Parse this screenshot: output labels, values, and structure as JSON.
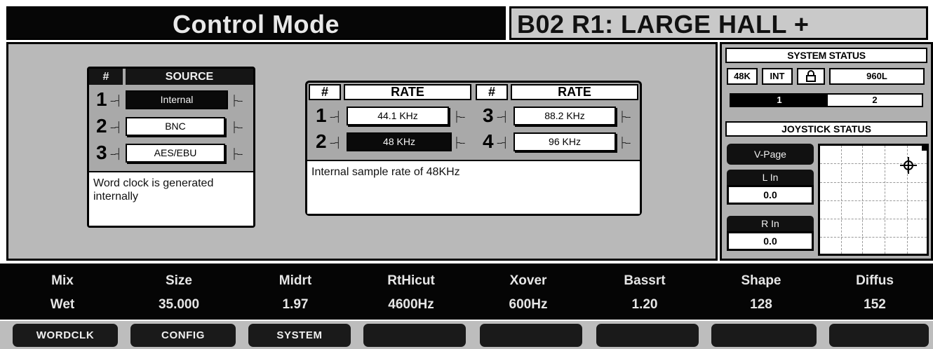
{
  "header": {
    "title": "Control Mode",
    "preset": "B02 R1: LARGE HALL +"
  },
  "source_panel": {
    "hash": "#",
    "header": "SOURCE",
    "rows": [
      {
        "num": "1",
        "label": "Internal"
      },
      {
        "num": "2",
        "label": "BNC"
      },
      {
        "num": "3",
        "label": "AES/EBU"
      }
    ],
    "description": "Word clock is generated internally"
  },
  "rate_panel": {
    "hash": "#",
    "header": "RATE",
    "rows": [
      {
        "num": "1",
        "label": "44.1 KHz"
      },
      {
        "num": "2",
        "label": "48 KHz"
      },
      {
        "num": "3",
        "label": "88.2 KHz"
      },
      {
        "num": "4",
        "label": "96 KHz"
      }
    ],
    "description": "Internal sample rate of 48KHz"
  },
  "system_status": {
    "title": "SYSTEM STATUS",
    "rate": "48K",
    "source": "INT",
    "model": "960L",
    "seg1": "1",
    "seg2": "2"
  },
  "joystick_status": {
    "title": "JOYSTICK STATUS",
    "vpage": "V-Page",
    "l_label": "L In",
    "l_value": "0.0",
    "r_label": "R In",
    "r_value": "0.0"
  },
  "params": [
    {
      "name": "Mix",
      "value": "Wet"
    },
    {
      "name": "Size",
      "value": "35.000"
    },
    {
      "name": "Midrt",
      "value": "1.97"
    },
    {
      "name": "RtHicut",
      "value": "4600Hz"
    },
    {
      "name": "Xover",
      "value": "600Hz"
    },
    {
      "name": "Bassrt",
      "value": "1.20"
    },
    {
      "name": "Shape",
      "value": "128"
    },
    {
      "name": "Diffus",
      "value": "152"
    }
  ],
  "softkeys": [
    {
      "label": "WORDCLK"
    },
    {
      "label": "CONFIG"
    },
    {
      "label": "SYSTEM"
    },
    {
      "label": ""
    },
    {
      "label": ""
    },
    {
      "label": ""
    },
    {
      "label": ""
    },
    {
      "label": ""
    }
  ]
}
